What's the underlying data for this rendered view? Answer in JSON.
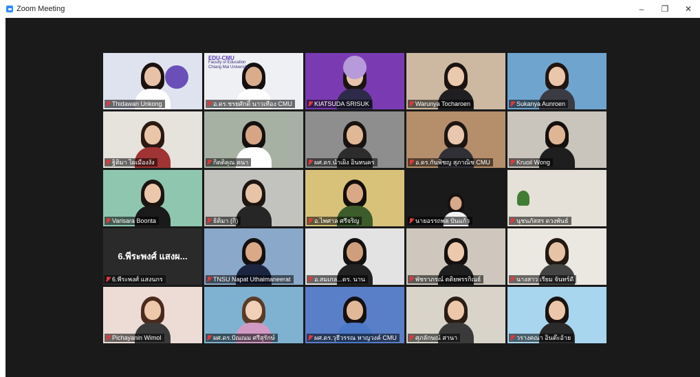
{
  "window": {
    "title": "Zoom Meeting",
    "controls": {
      "minimize": "–",
      "restore": "❐",
      "close": "✕"
    }
  },
  "colors": {
    "stage": "#1a1a1a",
    "active_speaker": "#b8d34a",
    "muted": "#e0393e"
  },
  "participants": [
    {
      "name": "Thidawan Unkong",
      "bg": "#dfe3f0",
      "skin": "#e7c2a6",
      "hair": "#1b1210",
      "shirt": "#ffffff",
      "muted": true
    },
    {
      "name": "อ.ดร.ชรยศักดิ์ นาวเทือง CMU",
      "bg": "#eef0f4",
      "skin": "#d9ad8c",
      "hair": "#141010",
      "shirt": "#ffffff",
      "muted": true,
      "logo_lines": [
        "EDU-CMU",
        "Faculty of Education",
        "Chiang Mai University"
      ]
    },
    {
      "name": "KIATSUDA SRISUK",
      "bg": "#7a3bb2",
      "skin": "#e8c6ad",
      "hair": "#1c1411",
      "shirt": "#2e2a4a",
      "muted": true,
      "active": true
    },
    {
      "name": "Warunya Tocharoen",
      "bg": "#cdb9a1",
      "skin": "#ebc9ae",
      "hair": "#1b1310",
      "shirt": "#1f1f22",
      "muted": true
    },
    {
      "name": "Sukanya Aunroen",
      "bg": "#6fa4cf",
      "skin": "#eac7ab",
      "hair": "#201511",
      "shirt": "#3b3b44",
      "muted": true
    },
    {
      "name": "ฐิติมา ไผเมืองงัง",
      "bg": "#e6e2dc",
      "skin": "#eac6a8",
      "hair": "#2a1a12",
      "shirt": "#a03434",
      "muted": true
    },
    {
      "name": "กิตติคุณ คนา",
      "bg": "#a7b1a3",
      "skin": "#d6a585",
      "hair": "#141010",
      "shirt": "#ffffff",
      "muted": true
    },
    {
      "name": "ผศ.ดร.นำเผิง อินทนคร",
      "bg": "#8e8e8e",
      "skin": "#e0b896",
      "hair": "#181210",
      "shirt": "#2c2c2c",
      "muted": true
    },
    {
      "name": "อ.ดร.กันพิชญ สุภาณิช CMU",
      "bg": "#b58e6b",
      "skin": "#e9c7ad",
      "hair": "#1c1512",
      "shirt": "#2f2f35",
      "muted": true
    },
    {
      "name": "Kruoil Wong",
      "bg": "#c9c4bc",
      "skin": "#dfb695",
      "hair": "#15100d",
      "shirt": "#1e1e1e",
      "muted": true
    },
    {
      "name": "Varisara Boonta",
      "bg": "#8ec6b0",
      "skin": "#ebc8ab",
      "hair": "#1c1411",
      "shirt": "#1a1a1a",
      "muted": true
    },
    {
      "name": "ธิติมา (กิ)",
      "bg": "#c2c2bf",
      "skin": "#e8c4a6",
      "hair": "#1e1511",
      "shirt": "#262626",
      "muted": true
    },
    {
      "name": "อ.ไพศาล ศรีจริญ",
      "bg": "#d8c27a",
      "skin": "#d9a987",
      "hair": "#120e0c",
      "shirt": "#3d5c2b",
      "muted": true
    },
    {
      "name": "นายอรรถพล ปันแก้ว",
      "bg": "#1a1a1a",
      "skin": "#d7a98a",
      "hair": "#161010",
      "shirt": "#f2f2f2",
      "muted": true,
      "small_video": true
    },
    {
      "name": "นุชนภัสสร ดวงพันธ์",
      "bg": "#e6e1d8",
      "skin": "#e0bb9b",
      "hair": "#1a1310",
      "shirt": "#333333",
      "muted": true,
      "empty": true
    },
    {
      "name": "6.พีระพงศ์ แสงนกร",
      "bg": "#2a2a2a",
      "muted": true,
      "avatar_text": "6.พีระพงศ์ แสงผ..."
    },
    {
      "name": "TNSU Napat Uthaimaneerat",
      "bg": "#8aa8c9",
      "skin": "#d9a988",
      "hair": "#141010",
      "shirt": "#1c2540",
      "muted": true
    },
    {
      "name": "อ.สมเกล...ดร. นาน",
      "bg": "#e3e3e3",
      "skin": "#cf9f7d",
      "hair": "#131010",
      "shirt": "#222222",
      "muted": true
    },
    {
      "name": "พัชราภรณ์ ตติยพรรกิณธ์",
      "bg": "#cfc7bd",
      "skin": "#ecc8ac",
      "hair": "#15100e",
      "shirt": "#1e1e1e",
      "muted": true
    },
    {
      "name": "นางสาว เรียม จันทร์ดี",
      "bg": "#ebe7e1",
      "skin": "#e6c3a4",
      "hair": "#231812",
      "shirt": "#444444",
      "muted": true
    },
    {
      "name": "Pichayanin Wimol",
      "bg": "#ecdcd5",
      "skin": "#eec8ab",
      "hair": "#4a2a1c",
      "shirt": "#3a3a3a",
      "muted": true
    },
    {
      "name": "ผศ.ดร.ปัณณม ศรีสุรักษ์",
      "bg": "#7fb2d1",
      "skin": "#f0d0b8",
      "hair": "#5b3b26",
      "shirt": "#d19ac4",
      "muted": true
    },
    {
      "name": "ผศ.ดร.วุธีวรรณ หาญวงค์ CMU",
      "bg": "#5a7fc9",
      "skin": "#e2b998",
      "hair": "#151010",
      "shirt": "#4b78c7",
      "muted": true
    },
    {
      "name": "ศุภลักษณ์ สานา",
      "bg": "#d8d4ca",
      "skin": "#ecc7aa",
      "hair": "#2b1c14",
      "shirt": "#3a3a3a",
      "muted": true
    },
    {
      "name": "วรางคณา อินต๊ะอ้าย",
      "bg": "#a7d6ee",
      "skin": "#ebc6a8",
      "hair": "#191210",
      "shirt": "#2a2a2a",
      "muted": true
    }
  ]
}
